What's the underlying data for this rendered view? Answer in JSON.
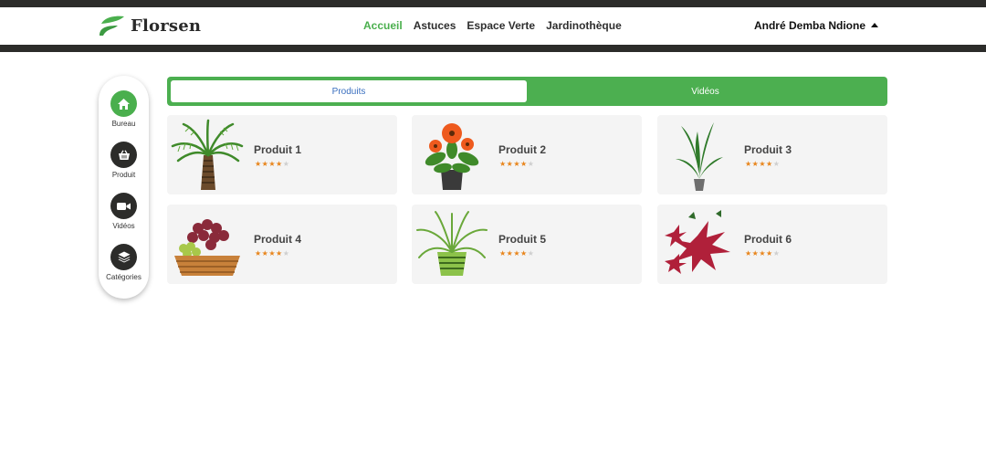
{
  "brand": {
    "name": "Florsen",
    "accent": "#4aaf4d",
    "dark": "#2c2c2a"
  },
  "nav": {
    "items": [
      {
        "label": "Accueil",
        "active": true
      },
      {
        "label": "Astuces",
        "active": false
      },
      {
        "label": "Espace Verte",
        "active": false
      },
      {
        "label": "Jardinothèque",
        "active": false
      }
    ]
  },
  "user": {
    "name": "André Demba Ndione"
  },
  "sidebar": {
    "items": [
      {
        "label": "Bureau",
        "icon": "home-icon",
        "active": true
      },
      {
        "label": "Produit",
        "icon": "basket-icon",
        "active": false
      },
      {
        "label": "Vidéos",
        "icon": "video-camera-icon",
        "active": false
      },
      {
        "label": "Catégories",
        "icon": "layers-icon",
        "active": false
      }
    ]
  },
  "tabs": {
    "active": "Produits",
    "other": "Vidéos"
  },
  "products": [
    {
      "name": "Produit 1",
      "rating": 4,
      "max": 5,
      "image": "palm-tree-image"
    },
    {
      "name": "Produit 2",
      "rating": 4,
      "max": 5,
      "image": "orange-flower-pot-image"
    },
    {
      "name": "Produit 3",
      "rating": 4,
      "max": 5,
      "image": "dracaena-plant-image"
    },
    {
      "name": "Produit 4",
      "rating": 4,
      "max": 5,
      "image": "grape-basket-image"
    },
    {
      "name": "Produit 5",
      "rating": 4,
      "max": 5,
      "image": "spider-plant-image"
    },
    {
      "name": "Produit 6",
      "rating": 4,
      "max": 5,
      "image": "red-hibiscus-image"
    }
  ]
}
